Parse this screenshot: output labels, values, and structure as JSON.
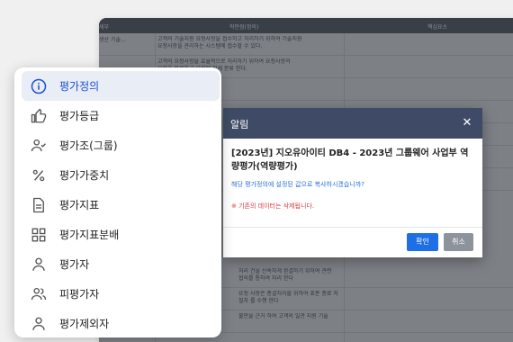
{
  "background": {
    "header_labels": [
      "세부",
      "착안점(정의)",
      "핵심요소"
    ],
    "rows": [
      {
        "left": "생산 기술...",
        "text": "고객의 기술지원 요청사항을 접수하고 처리하기 위하여 기술지원\n요청사항을 관리하는 시스템에 접수할 수 있다."
      },
      {
        "left": "",
        "text": "고객의 요청사항을 효율적으로 처리하기 위하여 요청사항의\n유형을 분류하고 유형에 맞게 분류 한다."
      },
      {
        "left": "",
        "text": ""
      },
      {
        "left": "",
        "text": ""
      },
      {
        "left": "",
        "text": ""
      },
      {
        "left": "",
        "text": ""
      },
      {
        "left": "",
        "text": ""
      },
      {
        "left": "",
        "text": "처리 건을 신속하게 완결하기 위하여 관련\n협의를 통하여 처리 한다"
      },
      {
        "left": "",
        "text": "요청 사항은 종결처리를 위하여 표준 종료 처\n절차 를 수행 한다"
      },
      {
        "left": "",
        "text": "불만을 근거 하여 고객의 일관 지원 기술"
      }
    ]
  },
  "dialog": {
    "title": "알림",
    "close_icon": "close-icon",
    "heading": "[2023년] 지오유아이티 DB4 - 2023년 그룹웨어 사업부 역량평가(역량평가)",
    "question": "해당 평가정의에 설정된 값으로 복사하시겠습니까?",
    "warning": "※ 기존의 데이터는 삭제됩니다.",
    "ok_label": "확인",
    "cancel_label": "취소",
    "ok_color": "#1e6fe6",
    "cancel_color": "#8d939d"
  },
  "menu": {
    "items": [
      {
        "label": "평가정의",
        "icon": "info-icon",
        "active": true
      },
      {
        "label": "평가등급",
        "icon": "thumbs-up-icon",
        "active": false
      },
      {
        "label": "평가조(그룹)",
        "icon": "user-check-icon",
        "active": false
      },
      {
        "label": "평가가중치",
        "icon": "percent-icon",
        "active": false
      },
      {
        "label": "평가지표",
        "icon": "document-icon",
        "active": false
      },
      {
        "label": "평가지표분배",
        "icon": "grid-icon",
        "active": false
      },
      {
        "label": "평가자",
        "icon": "user-icon",
        "active": false
      },
      {
        "label": "피평가자",
        "icon": "users-icon",
        "active": false
      },
      {
        "label": "평가제외자",
        "icon": "user-minus-icon",
        "active": false
      }
    ],
    "active_color": "#1b4fd1"
  }
}
